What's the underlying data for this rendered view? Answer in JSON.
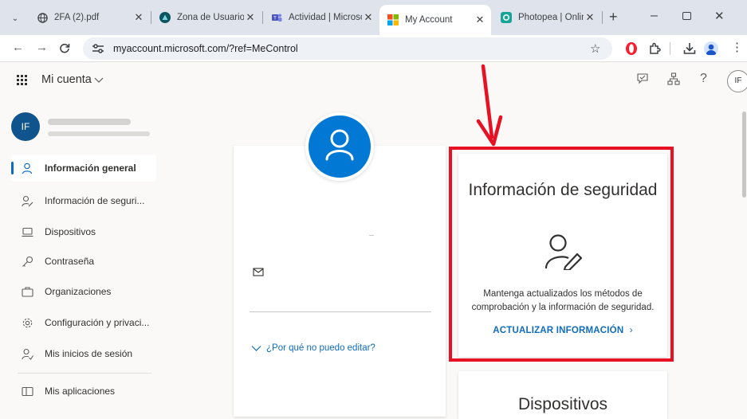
{
  "browser": {
    "tabs": [
      {
        "title": "2FA (2).pdf"
      },
      {
        "title": "Zona de Usuarios"
      },
      {
        "title": "Actividad | Microsoft"
      },
      {
        "title": "My Account"
      },
      {
        "title": "Photopea | Online"
      }
    ],
    "url": "myaccount.microsoft.com/?ref=MeControl"
  },
  "app": {
    "title": "Mi cuenta",
    "avatar_initials": "IF",
    "header_avatar_initials": "IF"
  },
  "sidebar": {
    "items": [
      {
        "label": "Información general",
        "icon": "person-icon"
      },
      {
        "label": "Información de seguri...",
        "icon": "person-key-icon"
      },
      {
        "label": "Dispositivos",
        "icon": "laptop-icon"
      },
      {
        "label": "Contraseña",
        "icon": "key-icon"
      },
      {
        "label": "Organizaciones",
        "icon": "briefcase-icon"
      },
      {
        "label": "Configuración y privaci...",
        "icon": "settings-icon"
      },
      {
        "label": "Mis inicios de sesión",
        "icon": "person-signin-icon"
      },
      {
        "label": "Mis aplicaciones",
        "icon": "apps-icon"
      }
    ]
  },
  "profile_card": {
    "edit_link": "¿Por qué no puedo editar?"
  },
  "security_card": {
    "title": "Información de seguridad",
    "description": "Mantenga actualizados los métodos de comprobación y la información de seguridad.",
    "action": "ACTUALIZAR INFORMACIÓN"
  },
  "devices_card": {
    "title": "Dispositivos"
  },
  "colors": {
    "accent": "#0f6cbd",
    "annotation": "#e81123"
  }
}
